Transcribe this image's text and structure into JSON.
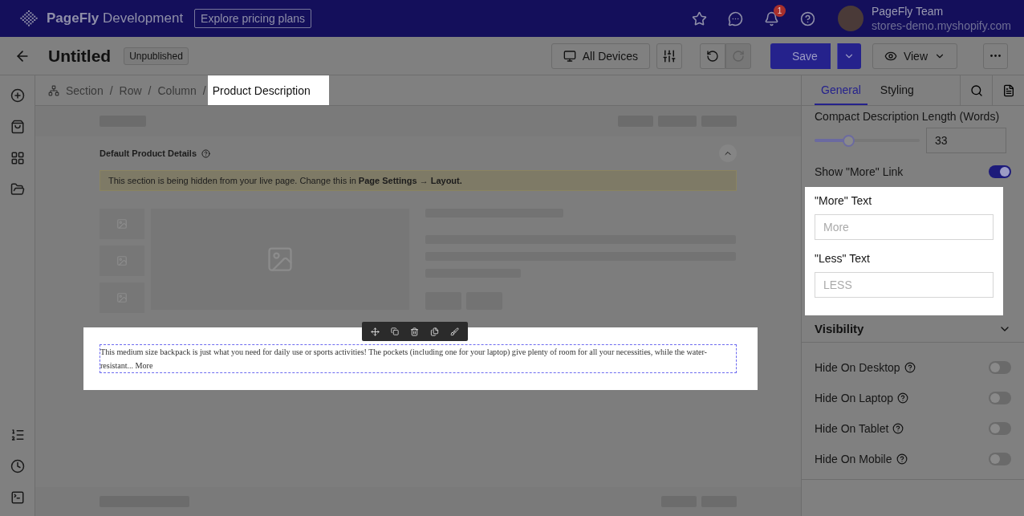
{
  "topbar": {
    "brand": "PageFly",
    "brand_suffix": "Development",
    "pricing_button": "Explore pricing plans",
    "notifications_badge": "1",
    "user": {
      "name": "PageFly Team",
      "store": "stores-demo.myshopify.com"
    }
  },
  "toolbar": {
    "title": "Untitled",
    "status": "Unpublished",
    "device": "All Devices",
    "history": [
      {
        "kind": "undo",
        "disabled": false
      },
      {
        "kind": "redo",
        "disabled": true
      }
    ],
    "save": "Save",
    "view": "View"
  },
  "breadcrumb": {
    "separator": "/",
    "items": [
      {
        "label": "Section",
        "selected": false
      },
      {
        "label": "Row",
        "selected": false
      },
      {
        "label": "Column",
        "selected": false
      },
      {
        "label": "Product Description",
        "selected": true
      }
    ]
  },
  "canvas": {
    "section_title": "Default Product Details",
    "notice": "This section is being hidden from your live page. Change this in **Page Settings → Layout.**",
    "description": "This medium size backpack is just what you need for daily use or sports activities! The pockets (including one for your laptop) give plenty of room for all your necessities, while the water-resistant...",
    "more_link": "More"
  },
  "panel": {
    "tabs": [
      {
        "label": "General",
        "selected": true
      },
      {
        "label": "Styling",
        "selected": false
      }
    ],
    "length": {
      "label": "Compact Description Length (Words)",
      "level": 0.32,
      "value": "33"
    },
    "show_more": {
      "label": "Show \"More\" Link",
      "on": true
    },
    "text_fields": [
      {
        "label": "\"More\" Text",
        "placeholder": "More"
      },
      {
        "label": "\"Less\" Text",
        "placeholder": "LESS"
      }
    ],
    "visibility": {
      "title": "Visibility",
      "toggles": [
        {
          "label": "Hide On Desktop",
          "on": false
        },
        {
          "label": "Hide On Laptop",
          "on": false
        },
        {
          "label": "Hide On Tablet",
          "on": false
        },
        {
          "label": "Hide On Mobile",
          "on": false
        }
      ]
    }
  }
}
